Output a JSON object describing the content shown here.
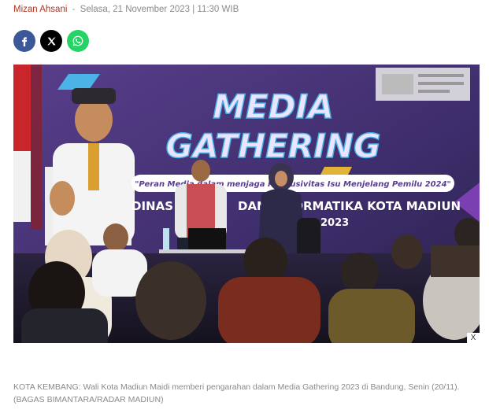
{
  "article": {
    "author": "Mizan Ahsani",
    "separator": "-",
    "date": "Selasa, 21 November 2023 | 11:30 WIB"
  },
  "share": [
    {
      "name": "facebook",
      "icon": "facebook-icon",
      "color": "#3b5998"
    },
    {
      "name": "x",
      "icon": "x-icon",
      "color": "#000000"
    },
    {
      "name": "whatsapp",
      "icon": "whatsapp-icon",
      "color": "#25d366"
    }
  ],
  "photo": {
    "banner_title_line1": "MEDIA",
    "banner_title_line2": "GATHERING",
    "banner_subtitle": "\"Peran Media dalam menjaga Kondusivitas Isu Menjelang Pemilu 2024\"",
    "banner_org_left": "DINAS",
    "banner_org_right": "DAN INFORMATIKA KOTA MADIUN",
    "banner_date": "2023",
    "accent_colors": [
      "#4bb3e6",
      "#f2c230",
      "#7a3fb0"
    ]
  },
  "ad": {
    "close_label": "X"
  },
  "caption": "KOTA KEMBANG: Wali Kota Madiun Maidi memberi pengarahan dalam Media Gathering 2023 di Bandung, Senin (20/11). (BAGAS BIMANTARA/RADAR MADIUN)"
}
